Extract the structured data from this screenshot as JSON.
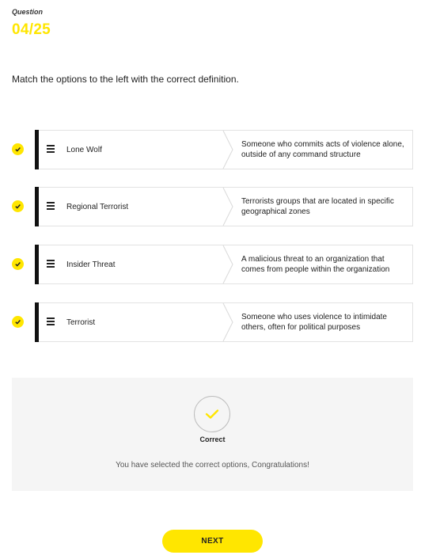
{
  "question": {
    "label": "Question",
    "number": "04/25"
  },
  "instruction": "Match the options to the left with the correct definition.",
  "matches": [
    {
      "term": "Lone Wolf",
      "definition": "Someone who commits acts of violence alone, outside of any command structure"
    },
    {
      "term": "Regional Terrorist",
      "definition": "Terrorists groups that are located in specific geographical zones"
    },
    {
      "term": "Insider Threat",
      "definition": "A malicious threat to an organization that comes from people within the organization"
    },
    {
      "term": "Terrorist",
      "definition": "Someone who uses violence to intimidate others, often for political purposes"
    }
  ],
  "feedback": {
    "status": "Correct",
    "message": "You have selected the correct options, Congratulations!"
  },
  "next_button": {
    "label": "NEXT"
  },
  "colors": {
    "accent": "#ffe600",
    "bar": "#111111",
    "panel": "#f5f5f5"
  },
  "icons": {
    "row_status": "check-icon",
    "drag": "drag-handle-icon",
    "feedback": "check-icon"
  }
}
